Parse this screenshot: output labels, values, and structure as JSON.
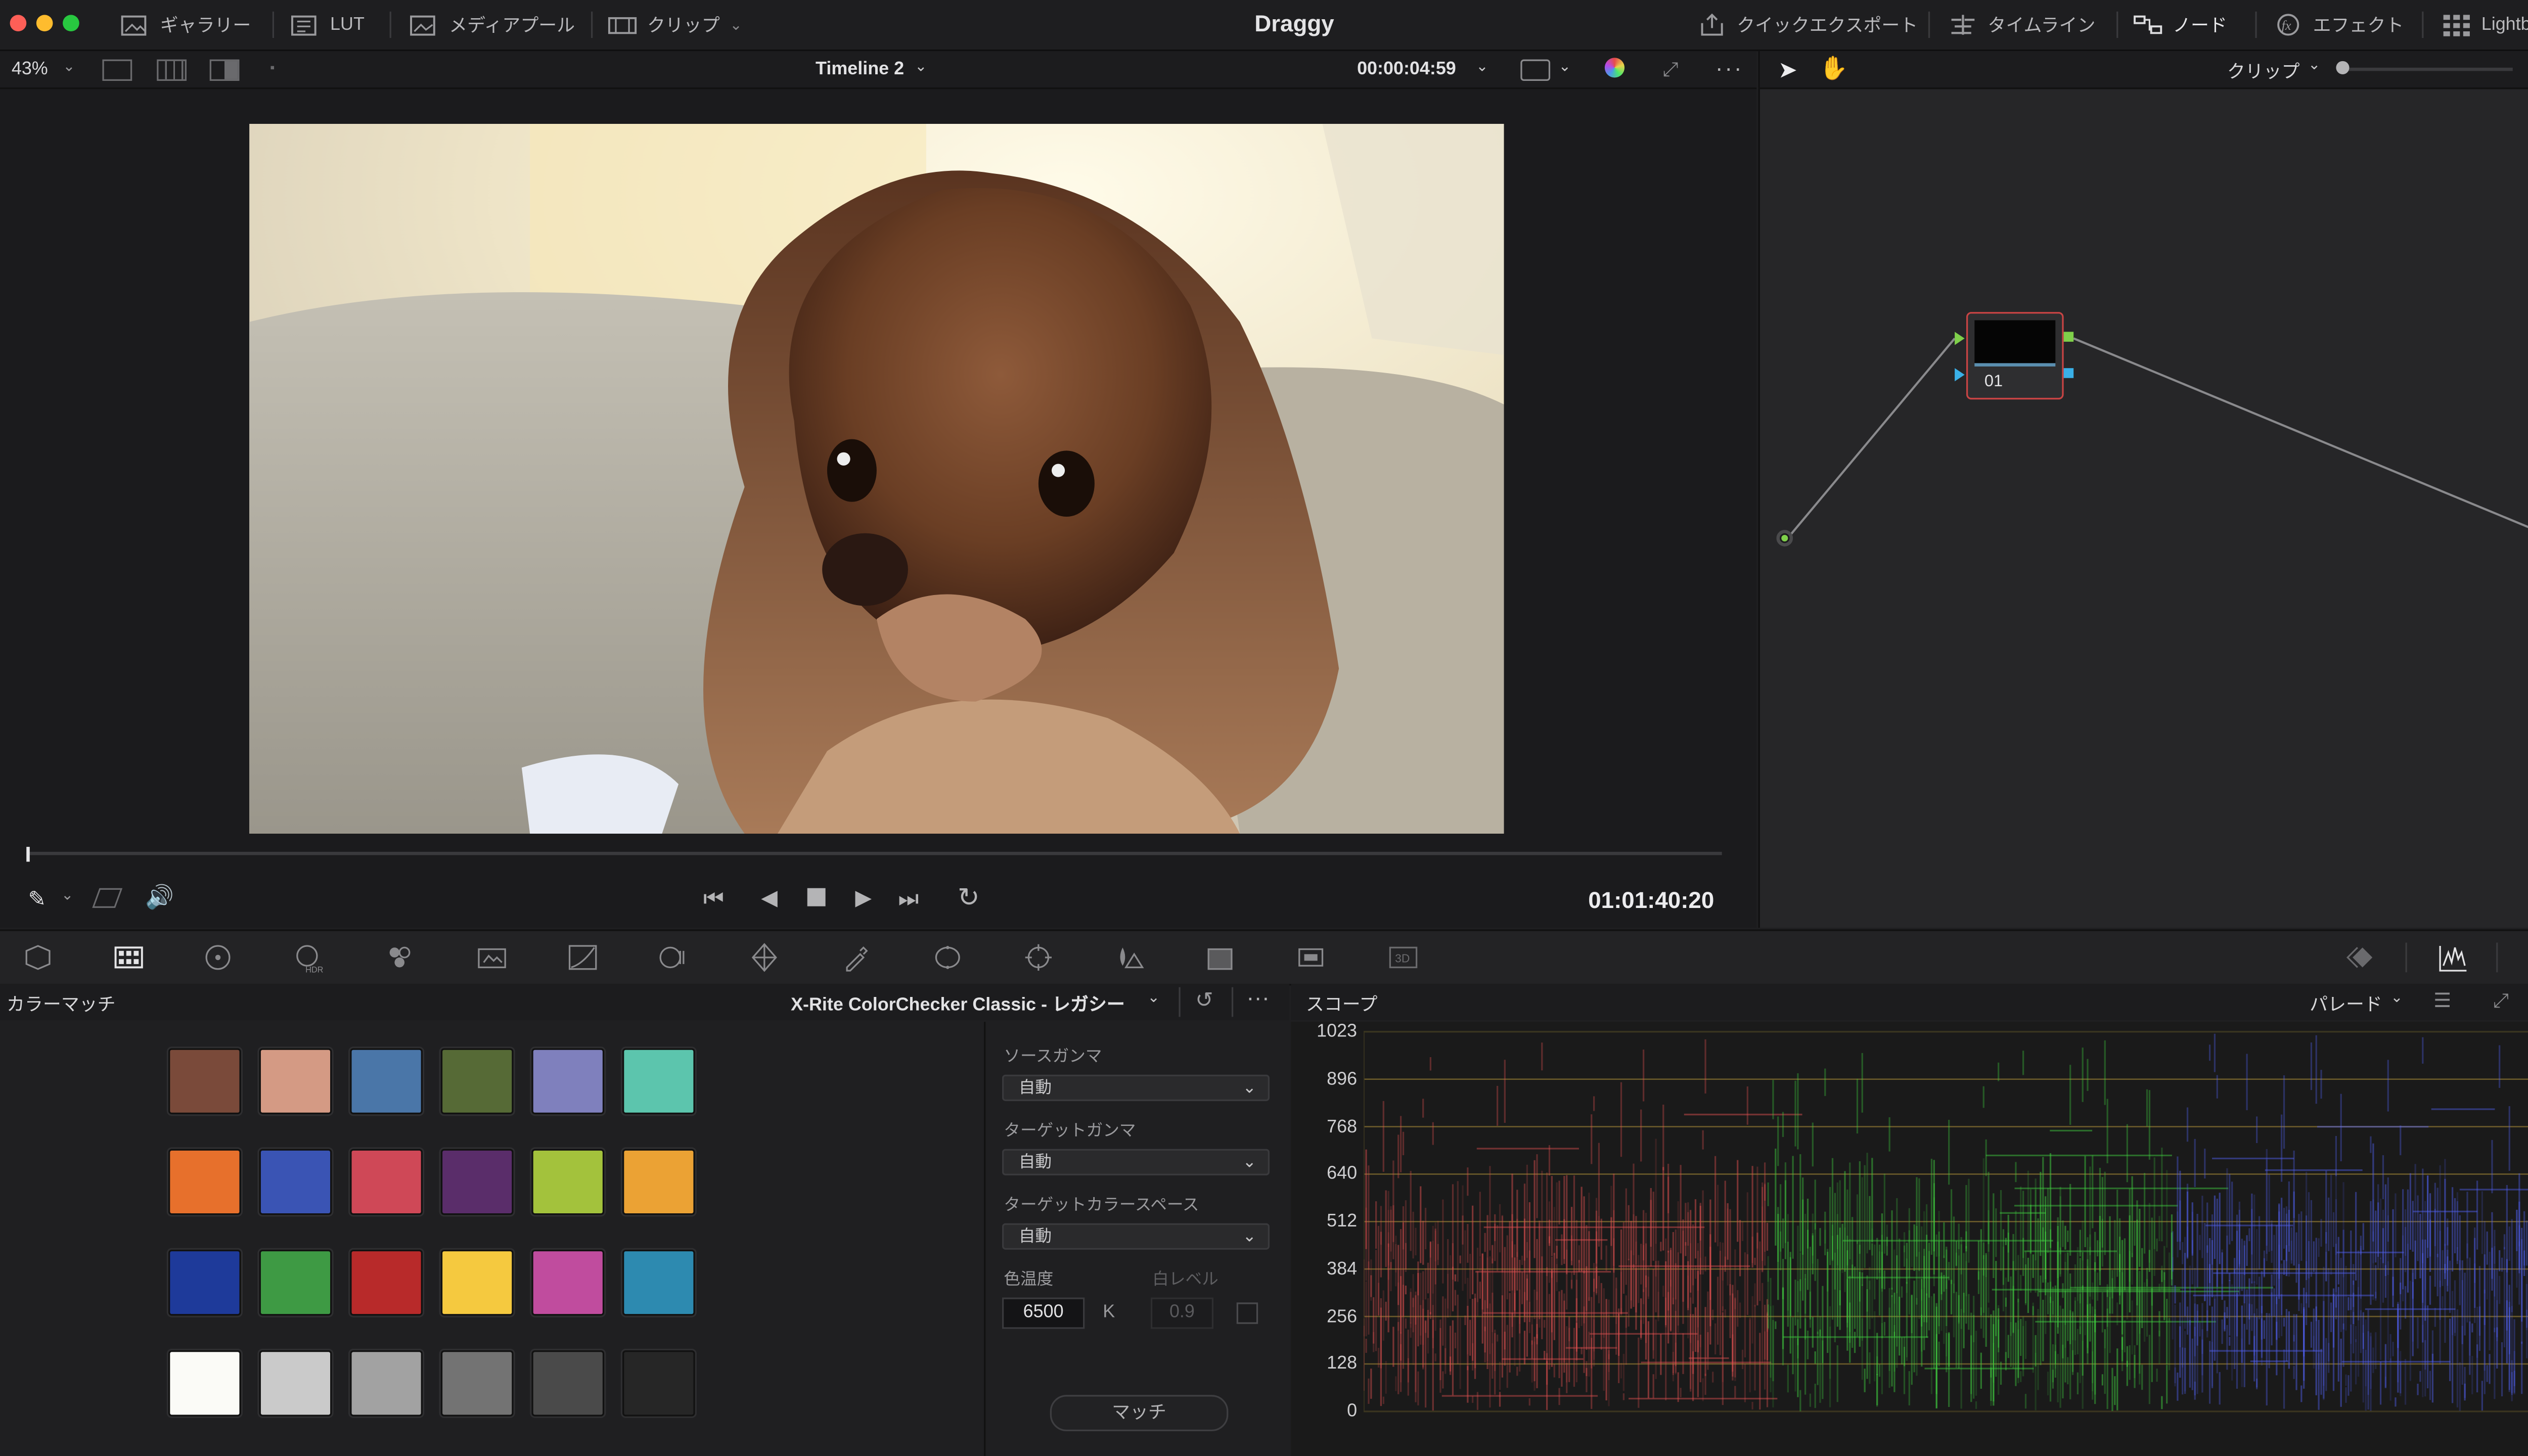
{
  "app": {
    "title": "Draggy"
  },
  "topbar": {
    "left_pages": [
      {
        "label": "ギャラリー",
        "icon": "gallery-icon"
      },
      {
        "label": "LUT",
        "icon": "lut-icon"
      },
      {
        "label": "メディアプール",
        "icon": "media-pool-icon"
      },
      {
        "label": "クリップ",
        "icon": "clips-icon"
      }
    ],
    "right_pages": [
      {
        "label": "クイックエクスポート",
        "icon": "quick-export-icon"
      },
      {
        "label": "タイムライン",
        "icon": "timeline-icon"
      },
      {
        "label": "ノード",
        "icon": "nodes-icon"
      },
      {
        "label": "エフェクト",
        "icon": "effects-icon"
      },
      {
        "label": "Lightbox",
        "icon": "lightbox-icon"
      }
    ]
  },
  "viewer": {
    "zoom": "43%",
    "timeline_name": "Timeline 2",
    "source_timecode": "00:00:04:59",
    "record_timecode": "01:01:40:20"
  },
  "nodes": {
    "mode": "クリップ",
    "node_label": "01"
  },
  "color_match": {
    "title": "カラーマッチ",
    "chart_name": "X-Rite ColorChecker Classic - レガシー",
    "swatches": [
      [
        "#7a4a3a",
        "#d49a84",
        "#4a76a8",
        "#566a36",
        "#7f80bd",
        "#5cc5ad"
      ],
      [
        "#e7702c",
        "#3a54b4",
        "#cf4857",
        "#5a2d6a",
        "#a3c23c",
        "#eba234"
      ],
      [
        "#1e3a9a",
        "#3e9a44",
        "#b82a2a",
        "#f5c93f",
        "#c04c9e",
        "#2d8ab0"
      ],
      [
        "#fbfbf7",
        "#cacaca",
        "#a2a2a2",
        "#737373",
        "#4a4a4a",
        "#262626"
      ]
    ],
    "source_gamma_label": "ソースガンマ",
    "source_gamma_value": "自動",
    "target_gamma_label": "ターゲットガンマ",
    "target_gamma_value": "自動",
    "target_colorspace_label": "ターゲットカラースペース",
    "target_colorspace_value": "自動",
    "color_temp_label": "色温度",
    "color_temp_value": "6500",
    "color_temp_unit": "K",
    "white_level_label": "白レベル",
    "white_level_value": "0.9",
    "match_button": "マッチ"
  },
  "scope": {
    "title": "スコープ",
    "mode": "パレード",
    "y_ticks": [
      "1023",
      "896",
      "768",
      "640",
      "512",
      "384",
      "256",
      "128",
      "0"
    ]
  }
}
